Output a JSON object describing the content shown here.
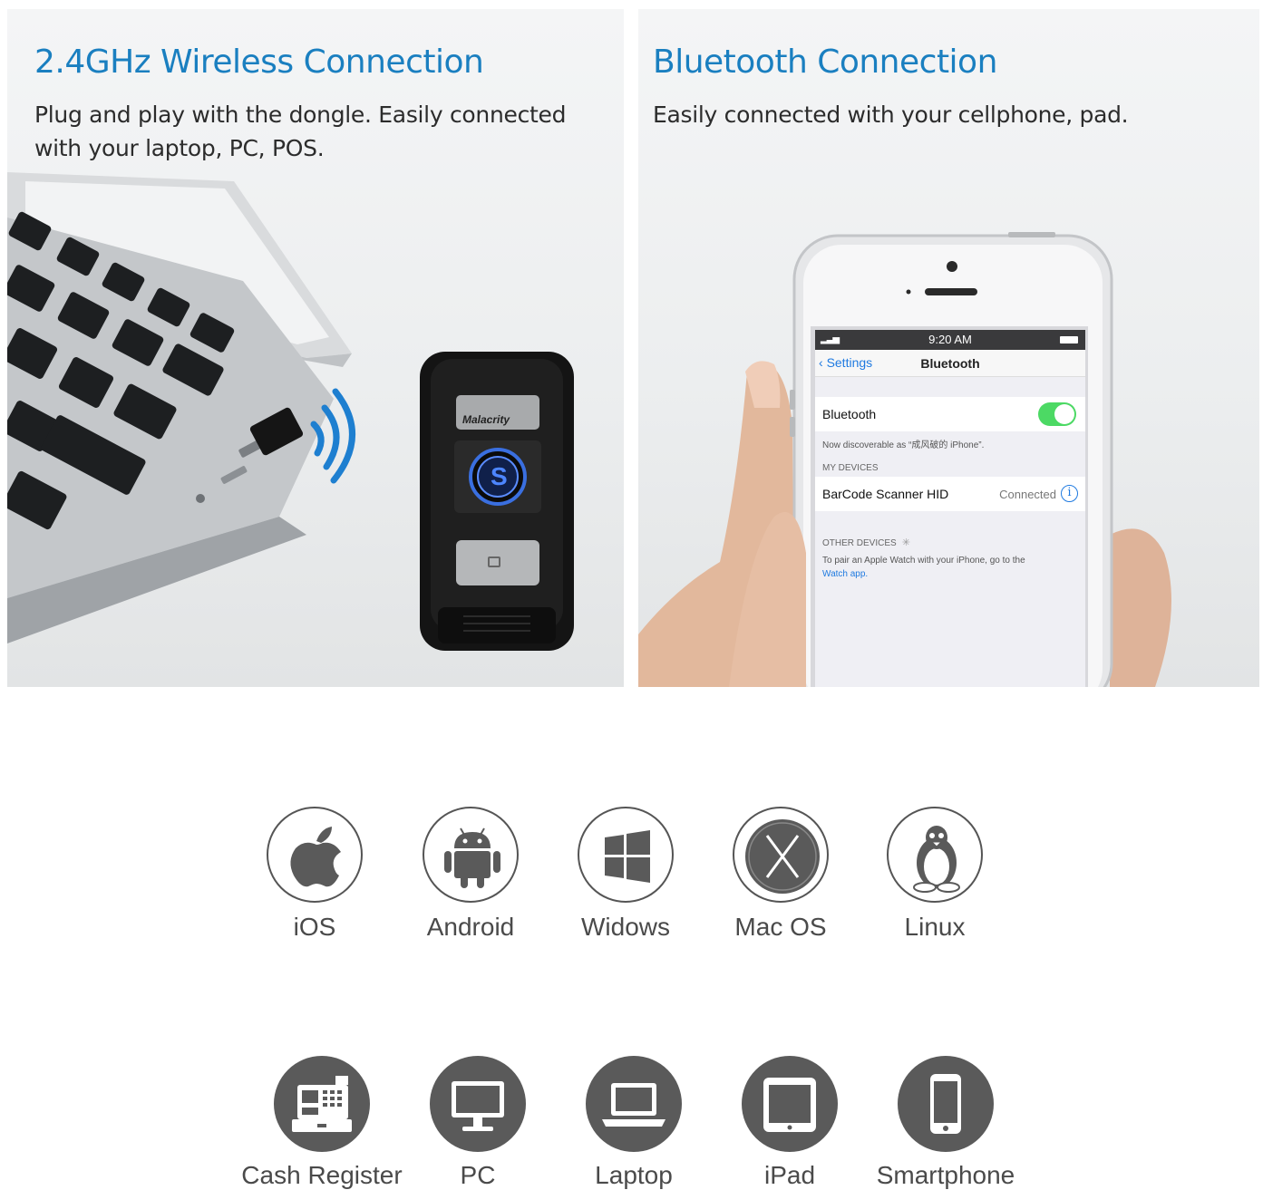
{
  "left_panel": {
    "title": "2.4GHz Wireless Connection",
    "description_line1": "Plug and play with the dongle. Easily connected",
    "description_line2": "with your laptop, PC, POS.",
    "scanner_brand": "Malacrity",
    "scanner_button_glyph": "S"
  },
  "right_panel": {
    "title": "Bluetooth Connection",
    "description": "Easily connected with your cellphone, pad.",
    "phone": {
      "status_time": "9:20 AM",
      "back_label": "Settings",
      "screen_title": "Bluetooth",
      "bluetooth_label": "Bluetooth",
      "bluetooth_on": true,
      "discoverable_note": "Now discoverable as “成风破的 iPhone”.",
      "my_devices_header": "MY DEVICES",
      "device_name": "BarCode Scanner HID",
      "device_status": "Connected",
      "other_devices_header": "OTHER DEVICES",
      "watch_note": "To pair an Apple Watch with your iPhone, go to the",
      "watch_link": "Watch app."
    }
  },
  "os_icons": [
    {
      "label": "iOS",
      "icon": "apple-icon"
    },
    {
      "label": "Android",
      "icon": "android-icon"
    },
    {
      "label": "Widows",
      "icon": "windows-icon"
    },
    {
      "label": "Mac OS",
      "icon": "mac-os-x-icon"
    },
    {
      "label": "Linux",
      "icon": "linux-penguin-icon"
    }
  ],
  "device_icons": [
    {
      "label": "Cash Register",
      "icon": "cash-register-icon"
    },
    {
      "label": "PC",
      "icon": "pc-monitor-icon"
    },
    {
      "label": "Laptop",
      "icon": "laptop-icon"
    },
    {
      "label": "iPad",
      "icon": "tablet-icon"
    },
    {
      "label": "Smartphone",
      "icon": "smartphone-icon"
    }
  ],
  "colors": {
    "title_blue": "#1a7fc0",
    "wireless_wave_blue": "#1e7fd0",
    "device_circle_gray": "#5a5a5a",
    "toggle_green": "#4cd964"
  }
}
